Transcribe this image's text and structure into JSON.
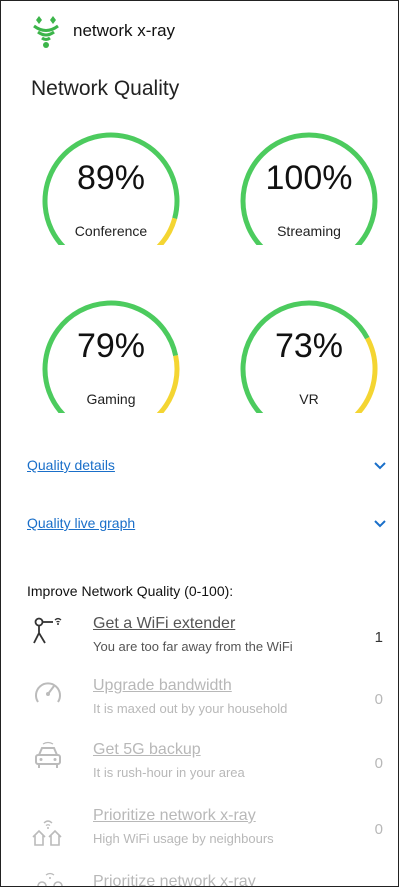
{
  "app": {
    "title": "network x-ray"
  },
  "section": {
    "title": "Network Quality"
  },
  "gauges": [
    {
      "percent_text": "89%",
      "label": "Conference",
      "value": 0.89
    },
    {
      "percent_text": "100%",
      "label": "Streaming",
      "value": 1.0
    },
    {
      "percent_text": "79%",
      "label": "Gaming",
      "value": 0.79
    },
    {
      "percent_text": "73%",
      "label": "VR",
      "value": 0.73
    }
  ],
  "colors": {
    "good": "#4ccb5e",
    "warn": "#f4d532",
    "link": "#1a6fc9"
  },
  "collapsibles": [
    {
      "label": "Quality details"
    },
    {
      "label": "Quality live graph"
    }
  ],
  "improve": {
    "title": "Improve Network Quality (0-100):",
    "items": [
      {
        "title": "Get a WiFi extender",
        "subtitle": "You are too far away from the WiFi",
        "score": "1",
        "icon": "wifi-extender-icon"
      },
      {
        "title": "Upgrade bandwidth",
        "subtitle": "It is maxed out by your household",
        "score": "0",
        "icon": "speedometer-icon"
      },
      {
        "title": "Get 5G backup",
        "subtitle": "It is rush-hour in your area",
        "score": "0",
        "icon": "car-icon"
      },
      {
        "title": "Prioritize network x-ray",
        "subtitle": "High WiFi usage by neighbours",
        "score": "0",
        "icon": "houses-wifi-icon"
      },
      {
        "title": "Prioritize network x-ray",
        "subtitle": "",
        "score": "",
        "icon": "people-wifi-icon"
      }
    ]
  }
}
